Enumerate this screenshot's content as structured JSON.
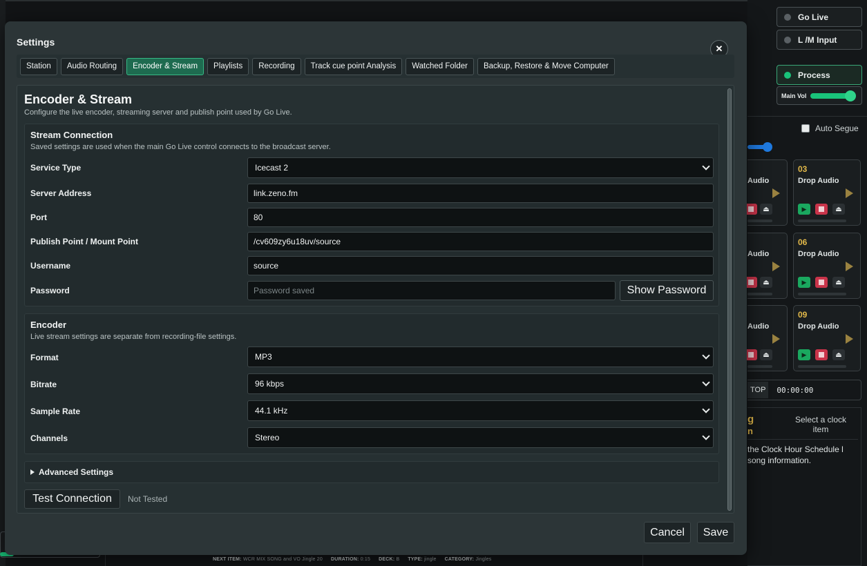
{
  "background": {
    "right_panel": {
      "go_live": "Go Live",
      "lm_input": "L /M Input",
      "process": "Process",
      "main_vol": "Main Vol",
      "auto_segue": "Auto Segue",
      "carts": [
        {
          "num": "",
          "label": "Audio"
        },
        {
          "num": "03",
          "label": "Drop Audio"
        },
        {
          "num": "",
          "label": "Audio"
        },
        {
          "num": "06",
          "label": "Drop Audio"
        },
        {
          "num": "",
          "label": "Audio"
        },
        {
          "num": "09",
          "label": "Drop Audio"
        }
      ],
      "stop_label": "TOP",
      "timer": "00:00:00",
      "clock_heading": "g",
      "clock_heading2": "n",
      "select_clock": "Select a clock item",
      "clock_hint": "the Clock Hour Schedule l song information."
    },
    "bottom_bar": {
      "next_item_label": "NEXT ITEM:",
      "next_item": "WCR MIX SONG and VO Jingle 20",
      "duration_label": "DURATION:",
      "duration": "0:15",
      "deck_label": "DECK:",
      "deck": "B",
      "type_label": "TYPE:",
      "type": "jingle",
      "category_label": "CATEGORY:",
      "category": "Jingles"
    }
  },
  "modal": {
    "title": "Settings",
    "close_glyph": "✕",
    "tabs": [
      {
        "label": "Station",
        "active": false
      },
      {
        "label": "Audio Routing",
        "active": false
      },
      {
        "label": "Encoder & Stream",
        "active": true
      },
      {
        "label": "Playlists",
        "active": false
      },
      {
        "label": "Recording",
        "active": false
      },
      {
        "label": "Track cue point Analysis",
        "active": false
      },
      {
        "label": "Watched Folder",
        "active": false
      },
      {
        "label": "Backup, Restore & Move Computer",
        "active": false
      }
    ],
    "page": {
      "title": "Encoder & Stream",
      "subtitle": "Configure the live encoder, streaming server and publish point used by Go Live."
    },
    "stream_connection": {
      "title": "Stream Connection",
      "subtitle": "Saved settings are used when the main Go Live control connects to the broadcast server.",
      "service_type_label": "Service Type",
      "service_type": "Icecast 2",
      "server_address_label": "Server Address",
      "server_address": "link.zeno.fm",
      "port_label": "Port",
      "port": "80",
      "mount_point_label": "Publish Point / Mount Point",
      "mount_point": "/cv609zy6u18uv/source",
      "username_label": "Username",
      "username": "source",
      "password_label": "Password",
      "password_placeholder": "Password saved",
      "show_password": "Show Password"
    },
    "encoder": {
      "title": "Encoder",
      "subtitle": "Live stream settings are separate from recording-file settings.",
      "format_label": "Format",
      "format": "MP3",
      "bitrate_label": "Bitrate",
      "bitrate": "96 kbps",
      "sample_rate_label": "Sample Rate",
      "sample_rate": "44.1 kHz",
      "channels_label": "Channels",
      "channels": "Stereo"
    },
    "advanced_label": "Advanced Settings",
    "test_connection": "Test Connection",
    "test_status": "Not Tested",
    "cancel": "Cancel",
    "save": "Save"
  },
  "colors": {
    "accent": "#37b985",
    "active_tab_bg": "#1e6b50",
    "cart_number": "#e2b94a",
    "process_led": "#19c37a"
  }
}
